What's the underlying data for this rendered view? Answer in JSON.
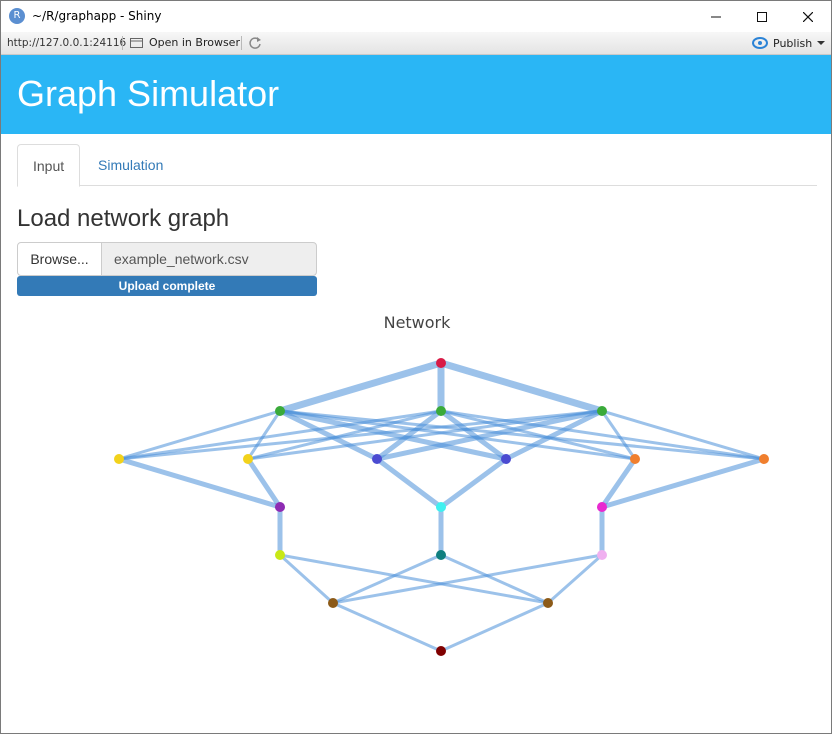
{
  "window": {
    "title": "~/R/graphapp - Shiny",
    "icon_letter": "R"
  },
  "toolbar": {
    "url": "http://127.0.0.1:24116",
    "open_in_browser": "Open in Browser",
    "publish": "Publish"
  },
  "app": {
    "title": "Graph Simulator"
  },
  "tabs": [
    {
      "label": "Input",
      "active": true
    },
    {
      "label": "Simulation",
      "active": false
    }
  ],
  "load": {
    "heading": "Load network graph",
    "browse_label": "Browse...",
    "file_name": "example_network.csv",
    "progress_label": "Upload complete",
    "progress_fraction": 1.0
  },
  "colors": {
    "navbar": "#2ab6f5",
    "edge": "#4a90d9",
    "progress": "#337ab7"
  },
  "chart_data": {
    "type": "network",
    "title": "Network",
    "nodes": [
      {
        "id": "n1",
        "color": "#d81b47"
      },
      {
        "id": "n2",
        "color": "#3aaa3a"
      },
      {
        "id": "n3",
        "color": "#3aaa3a"
      },
      {
        "id": "n4",
        "color": "#3aaa3a"
      },
      {
        "id": "n5",
        "color": "#f2d21b"
      },
      {
        "id": "n6",
        "color": "#f2d21b"
      },
      {
        "id": "n7",
        "color": "#4b4bd1"
      },
      {
        "id": "n8",
        "color": "#4b4bd1"
      },
      {
        "id": "n9",
        "color": "#f07f2e"
      },
      {
        "id": "n10",
        "color": "#f07f2e"
      },
      {
        "id": "n11",
        "color": "#8e2bb3"
      },
      {
        "id": "n12",
        "color": "#3ff0f0"
      },
      {
        "id": "n13",
        "color": "#e82ad0"
      },
      {
        "id": "n14",
        "color": "#c8e816"
      },
      {
        "id": "n15",
        "color": "#0f7f7f"
      },
      {
        "id": "n16",
        "color": "#f0b0f0"
      },
      {
        "id": "n17",
        "color": "#8c5a18"
      },
      {
        "id": "n18",
        "color": "#8c5a18"
      },
      {
        "id": "n19",
        "color": "#800000"
      }
    ],
    "edges": [
      {
        "from": "n1",
        "to": "n2",
        "weight": 3
      },
      {
        "from": "n1",
        "to": "n3",
        "weight": 3
      },
      {
        "from": "n1",
        "to": "n4",
        "weight": 3
      },
      {
        "from": "n2",
        "to": "n5",
        "weight": 1
      },
      {
        "from": "n2",
        "to": "n6",
        "weight": 1
      },
      {
        "from": "n2",
        "to": "n7",
        "weight": 2
      },
      {
        "from": "n2",
        "to": "n8",
        "weight": 2
      },
      {
        "from": "n2",
        "to": "n9",
        "weight": 1
      },
      {
        "from": "n2",
        "to": "n10",
        "weight": 1
      },
      {
        "from": "n3",
        "to": "n5",
        "weight": 1
      },
      {
        "from": "n3",
        "to": "n6",
        "weight": 1
      },
      {
        "from": "n3",
        "to": "n7",
        "weight": 2
      },
      {
        "from": "n3",
        "to": "n8",
        "weight": 2
      },
      {
        "from": "n3",
        "to": "n9",
        "weight": 1
      },
      {
        "from": "n3",
        "to": "n10",
        "weight": 1
      },
      {
        "from": "n4",
        "to": "n5",
        "weight": 1
      },
      {
        "from": "n4",
        "to": "n6",
        "weight": 1
      },
      {
        "from": "n4",
        "to": "n7",
        "weight": 2
      },
      {
        "from": "n4",
        "to": "n8",
        "weight": 2
      },
      {
        "from": "n4",
        "to": "n9",
        "weight": 1
      },
      {
        "from": "n4",
        "to": "n10",
        "weight": 1
      },
      {
        "from": "n5",
        "to": "n11",
        "weight": 2
      },
      {
        "from": "n6",
        "to": "n11",
        "weight": 2
      },
      {
        "from": "n7",
        "to": "n12",
        "weight": 2
      },
      {
        "from": "n8",
        "to": "n12",
        "weight": 2
      },
      {
        "from": "n9",
        "to": "n13",
        "weight": 2
      },
      {
        "from": "n10",
        "to": "n13",
        "weight": 2
      },
      {
        "from": "n11",
        "to": "n14",
        "weight": 2
      },
      {
        "from": "n12",
        "to": "n15",
        "weight": 2
      },
      {
        "from": "n13",
        "to": "n16",
        "weight": 2
      },
      {
        "from": "n14",
        "to": "n17",
        "weight": 1
      },
      {
        "from": "n14",
        "to": "n18",
        "weight": 1
      },
      {
        "from": "n15",
        "to": "n17",
        "weight": 1
      },
      {
        "from": "n15",
        "to": "n18",
        "weight": 1
      },
      {
        "from": "n16",
        "to": "n17",
        "weight": 1
      },
      {
        "from": "n16",
        "to": "n18",
        "weight": 1
      },
      {
        "from": "n17",
        "to": "n19",
        "weight": 1
      },
      {
        "from": "n18",
        "to": "n19",
        "weight": 1
      }
    ]
  }
}
